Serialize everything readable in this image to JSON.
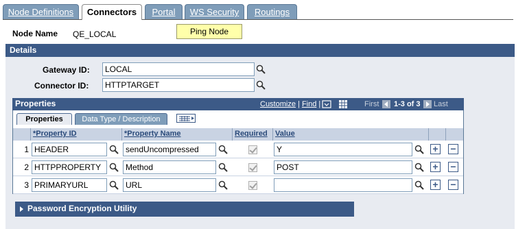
{
  "tabs": [
    {
      "label": "Node Definitions",
      "active": false
    },
    {
      "label": "Connectors",
      "active": true
    },
    {
      "label": "Portal",
      "active": false
    },
    {
      "label": "WS Security",
      "active": false
    },
    {
      "label": "Routings",
      "active": false
    }
  ],
  "node": {
    "label": "Node Name",
    "value": "QE_LOCAL",
    "ping_button": "Ping Node"
  },
  "details": {
    "title": "Details",
    "gateway_label": "Gateway ID:",
    "gateway_value": "LOCAL",
    "connector_label": "Connector ID:",
    "connector_value": "HTTPTARGET"
  },
  "properties": {
    "title": "Properties",
    "customize": "Customize",
    "find": "Find",
    "first": "First",
    "range": "1-3 of 3",
    "last": "Last",
    "subtabs": [
      "Properties",
      "Data Type / Description"
    ],
    "headers": {
      "property_id": "*Property ID",
      "property_name": "*Property Name",
      "required": "Required",
      "value": "Value"
    },
    "rows": [
      {
        "num": "1",
        "property_id": "HEADER",
        "property_name": "sendUncompressed",
        "required": true,
        "value": "Y"
      },
      {
        "num": "2",
        "property_id": "HTTPPROPERTY",
        "property_name": "Method",
        "required": true,
        "value": "POST"
      },
      {
        "num": "3",
        "property_id": "PRIMARYURL",
        "property_name": "URL",
        "required": true,
        "value": ""
      }
    ]
  },
  "password_section": {
    "title": "Password Encryption Utility"
  },
  "colors": {
    "bar": "#3c5a87",
    "tab": "#7f9db9",
    "ping": "#ffffaa",
    "panel": "#e8ebf1"
  },
  "icons": [
    "magnifier-icon",
    "download-icon",
    "grid-icon",
    "prev-arrow-icon",
    "next-arrow-icon",
    "add-row-icon",
    "delete-row-icon",
    "expand-grid-icon",
    "collapse-triangle-icon"
  ]
}
